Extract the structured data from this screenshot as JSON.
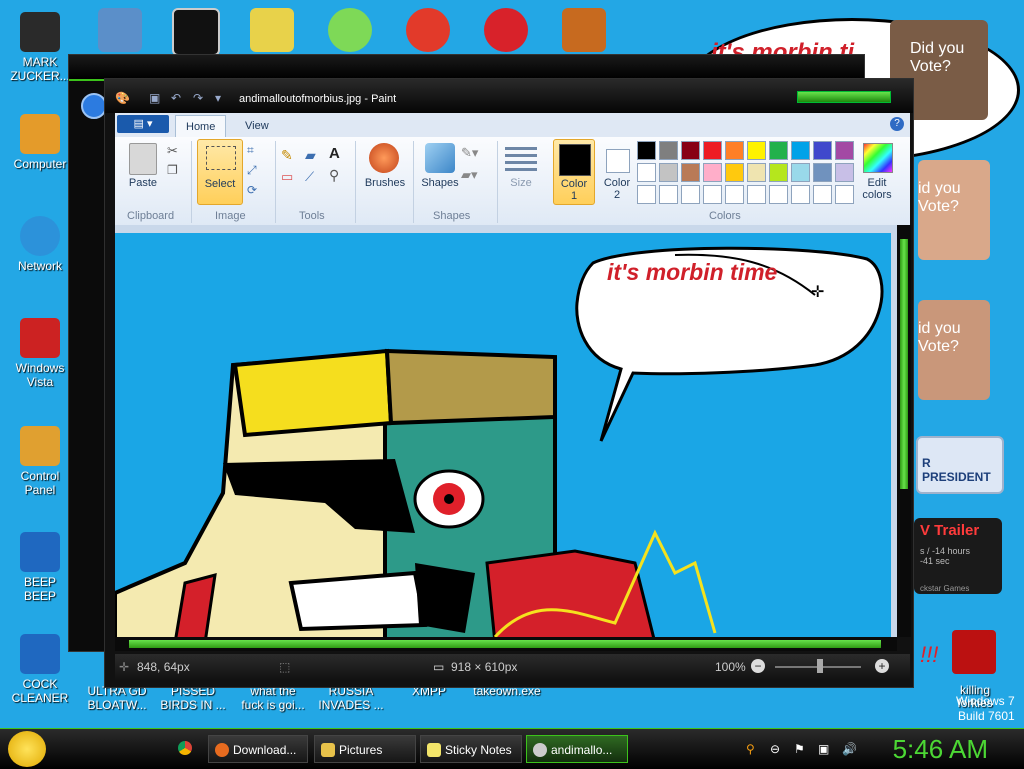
{
  "desktop": {
    "left_icons": [
      {
        "label": "MARK\nZUCKER...",
        "color": "#2a2a2a"
      },
      {
        "label": "Computer",
        "color": "#e49b2a"
      },
      {
        "label": "Network",
        "color": "#2c92da"
      },
      {
        "label": "Windows\nVista",
        "color": "#cc2222"
      },
      {
        "label": "Control\nPanel",
        "color": "#e0a030"
      },
      {
        "label": "BEEP\nBEEP",
        "color": "#1f68c0"
      },
      {
        "label": "COCK\nCLEANER",
        "color": "#1f68c0"
      }
    ],
    "bottom_labels": [
      "ULTRA GD\nBLOATW...",
      "PISSED\nBIRDS IN ...",
      "what the\nfuck is goi...",
      "RUSSIA\nINVADES ...",
      "XMPP",
      "takeown.exe"
    ],
    "right_bottom_label": "killing\nforkies",
    "watermark": "Windows 7\nBuild 7601"
  },
  "gadgets": {
    "bubble_text": "it's morbin ti",
    "vote1": "Did you\nVote?",
    "vote2": "id you\nVote?",
    "vote3": "id you\nVote?",
    "president": "R PRESIDENT",
    "trailer_title": "V Trailer",
    "trailer_lines": "s / -14 hours\n-41 sec",
    "trailer_footer": "ckstar Games",
    "exclaim": "!!!"
  },
  "paint": {
    "title": "andimalloutofmorbius.jpg - Paint",
    "tabs": {
      "file": "▤ ▾",
      "home": "Home",
      "view": "View"
    },
    "groups": {
      "clipboard": "Clipboard",
      "image": "Image",
      "tools": "Tools",
      "shapes": "Shapes",
      "colors": "Colors"
    },
    "buttons": {
      "paste": "Paste",
      "select": "Select",
      "brushes": "Brushes",
      "shapes": "Shapes",
      "size": "Size",
      "color1": "Color\n1",
      "color2": "Color\n2",
      "edit_colors": "Edit\ncolors"
    },
    "colors": {
      "color1": "#000000",
      "color2": "#ffffff",
      "palette_row1": [
        "#000000",
        "#7f7f7f",
        "#880015",
        "#ed1c24",
        "#ff7f27",
        "#fff200",
        "#22b14c",
        "#00a2e8",
        "#3f48cc",
        "#a349a4"
      ],
      "palette_row2": [
        "#ffffff",
        "#c3c3c3",
        "#b97a57",
        "#ffaec9",
        "#ffc90e",
        "#efe4b0",
        "#b5e61d",
        "#99d9ea",
        "#7092be",
        "#c8bfe7"
      ]
    },
    "canvas_text": "it's morbin time",
    "status": {
      "cursor": "848, 64px",
      "dimensions": "918 × 610px",
      "zoom": "100%"
    }
  },
  "taskbar": {
    "buttons": [
      "Download...",
      "Pictures",
      "Sticky Notes",
      "andimallo..."
    ],
    "clock": "5:46 AM"
  }
}
